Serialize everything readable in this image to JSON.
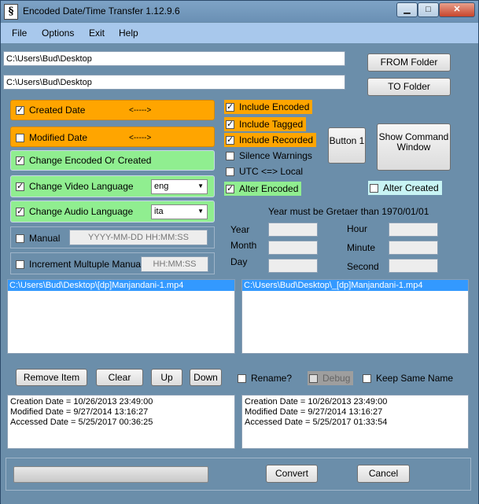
{
  "window": {
    "title": "Encoded Date/Time Transfer 1.12.9.6",
    "icon_glyph": "§"
  },
  "menu": [
    "File",
    "Options",
    "Exit",
    "Help"
  ],
  "paths": {
    "from": "C:\\Users\\Bud\\Desktop",
    "to": "C:\\Users\\Bud\\Desktop"
  },
  "buttons": {
    "from_folder": "FROM Folder",
    "to_folder": "TO Folder",
    "button1": "Button 1",
    "show_command": "Show Command Window",
    "remove_item": "Remove Item",
    "clear": "Clear",
    "up": "Up",
    "down": "Down",
    "convert": "Convert",
    "cancel": "Cancel"
  },
  "left_options": {
    "created_date": {
      "label": "Created Date",
      "arrow": "<----->",
      "checked": true
    },
    "modified_date": {
      "label": "Modified Date",
      "arrow": "<----->",
      "checked": false
    },
    "change_encoded": {
      "label": "Change Encoded Or Created",
      "checked": true
    },
    "video_lang": {
      "label": "Change Video Language",
      "value": "eng",
      "checked": true
    },
    "audio_lang": {
      "label": "Change Audio Language",
      "value": "ita",
      "checked": true
    },
    "manual": {
      "label": "Manual",
      "placeholder": "YYYY-MM-DD HH:MM:SS",
      "checked": false
    },
    "increment": {
      "label": "Increment Multuple Manual",
      "placeholder": "HH:MM:SS",
      "checked": false
    }
  },
  "mid_options": {
    "include_encoded": {
      "label": "Include Encoded",
      "checked": true
    },
    "include_tagged": {
      "label": "Include Tagged",
      "checked": true
    },
    "include_recorded": {
      "label": "Include Recorded",
      "checked": true
    },
    "silence_warnings": {
      "label": "Silence Warnings",
      "checked": false
    },
    "utc_local": {
      "label": "UTC  <=> Local",
      "checked": false
    },
    "alter_encoded": {
      "label": "Alter Encoded",
      "checked": true
    },
    "alter_created": {
      "label": "Alter Created",
      "checked": false
    }
  },
  "date_panel": {
    "note": "Year must be Gretaer than 1970/01/01",
    "year": "Year",
    "month": "Month",
    "day": "Day",
    "hour": "Hour",
    "minute": "Minute",
    "second": "Second"
  },
  "lists": {
    "left_item": "C:\\Users\\Bud\\Desktop\\[dp]Manjandani-1.mp4",
    "right_item": "C:\\Users\\Bud\\Desktop\\_[dp]Manjandani-1.mp4"
  },
  "bottom_options": {
    "rename": {
      "label": "Rename?",
      "checked": false
    },
    "debug": {
      "label": "Debug",
      "checked": false
    },
    "keep_same_name": {
      "label": "Keep Same Name",
      "checked": false
    }
  },
  "info_left": [
    "Creation Date = 10/26/2013 23:49:00",
    "Modified Date = 9/27/2014 13:16:27",
    "Accessed Date = 5/25/2017 00:36:25"
  ],
  "info_right": [
    "Creation Date = 10/26/2013 23:49:00",
    "Modified Date = 9/27/2014 13:16:27",
    "Accessed Date = 5/25/2017 01:33:54"
  ],
  "colors": {
    "orange": "#ffa500",
    "green": "#90ee90",
    "selection": "#3399ff"
  }
}
